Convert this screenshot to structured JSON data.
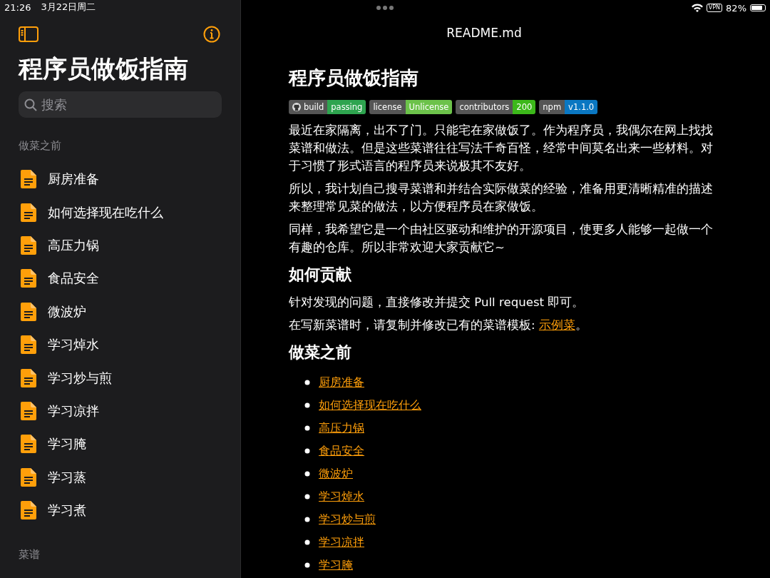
{
  "status_bar": {
    "time": "21:26",
    "date": "3月22日周二",
    "vpn": "VPN",
    "battery": "82%"
  },
  "sidebar": {
    "title": "程序员做饭指南",
    "search": {
      "placeholder": "搜索"
    },
    "sections": [
      {
        "heading": "做菜之前",
        "items": [
          {
            "label": "厨房准备"
          },
          {
            "label": "如何选择现在吃什么"
          },
          {
            "label": "高压力锅"
          },
          {
            "label": "食品安全"
          },
          {
            "label": "微波炉"
          },
          {
            "label": "学习焯水"
          },
          {
            "label": "学习炒与煎"
          },
          {
            "label": "学习凉拌"
          },
          {
            "label": "学习腌"
          },
          {
            "label": "学习蒸"
          },
          {
            "label": "学习煮"
          }
        ]
      },
      {
        "heading": "菜谱"
      }
    ]
  },
  "document": {
    "file_name": "README.md",
    "title": "程序员做饭指南",
    "badges": [
      {
        "kind": "github",
        "label": "build",
        "value": "passing",
        "color": "#2ea44f"
      },
      {
        "kind": "plain",
        "label": "license",
        "value": "Unlicense",
        "color": "#6cc24a"
      },
      {
        "kind": "plain",
        "label": "contributors",
        "value": "200",
        "color": "#3cb81a"
      },
      {
        "kind": "plain",
        "label": "npm",
        "value": "v1.1.0",
        "color": "#0a77c2"
      }
    ],
    "paragraphs": [
      "最近在家隔离，出不了门。只能宅在家做饭了。作为程序员，我偶尔在网上找找菜谱和做法。但是这些菜谱往往写法千奇百怪，经常中间莫名出来一些材料。对于习惯了形式语言的程序员来说极其不友好。",
      "所以，我计划自己搜寻菜谱和并结合实际做菜的经验，准备用更清晰精准的描述来整理常见菜的做法，以方便程序员在家做饭。",
      "同样，我希望它是一个由社区驱动和维护的开源项目，使更多人能够一起做一个有趣的仓库。所以非常欢迎大家贡献它~"
    ],
    "contribute": {
      "heading": "如何贡献",
      "lines": [
        {
          "text": "针对发现的问题，直接修改并提交 Pull request 即可。"
        },
        {
          "text": "在写新菜谱时，请复制并修改已有的菜谱模板: ",
          "link": "示例菜",
          "after": "。"
        }
      ]
    },
    "before_cooking": {
      "heading": "做菜之前",
      "links": [
        "厨房准备",
        "如何选择现在吃什么",
        "高压力锅",
        "食品安全",
        "微波炉",
        "学习焯水",
        "学习炒与煎",
        "学习凉拌",
        "学习腌"
      ]
    }
  }
}
